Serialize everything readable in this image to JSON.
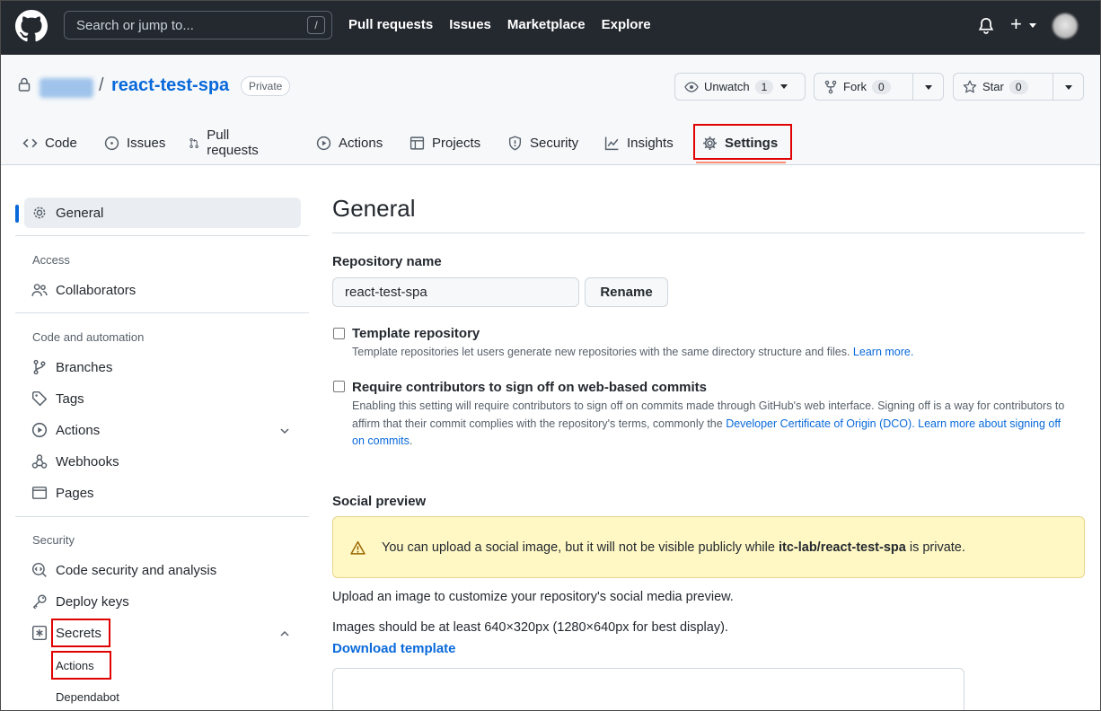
{
  "header": {
    "search_placeholder": "Search or jump to...",
    "search_key": "/",
    "nav": [
      "Pull requests",
      "Issues",
      "Marketplace",
      "Explore"
    ],
    "plus": "+"
  },
  "repo": {
    "separator": "/",
    "name": "react-test-spa",
    "visibility": "Private",
    "watch": {
      "label": "Unwatch",
      "count": "1"
    },
    "fork": {
      "label": "Fork",
      "count": "0"
    },
    "star": {
      "label": "Star",
      "count": "0"
    }
  },
  "tabs": [
    {
      "label": "Code",
      "icon": "code-icon"
    },
    {
      "label": "Issues",
      "icon": "issue-icon"
    },
    {
      "label": "Pull requests",
      "icon": "pull-request-icon"
    },
    {
      "label": "Actions",
      "icon": "play-icon"
    },
    {
      "label": "Projects",
      "icon": "table-icon"
    },
    {
      "label": "Security",
      "icon": "shield-icon"
    },
    {
      "label": "Insights",
      "icon": "graph-icon"
    },
    {
      "label": "Settings",
      "icon": "gear-icon",
      "selected": true
    }
  ],
  "sidebar": {
    "general": "General",
    "access_heading": "Access",
    "collaborators": "Collaborators",
    "code_automation_heading": "Code and automation",
    "branches": "Branches",
    "tags": "Tags",
    "actions": "Actions",
    "webhooks": "Webhooks",
    "pages": "Pages",
    "security_heading": "Security",
    "code_security": "Code security and analysis",
    "deploy_keys": "Deploy keys",
    "secrets": "Secrets",
    "secrets_actions": "Actions",
    "secrets_dependabot": "Dependabot"
  },
  "main": {
    "title": "General",
    "repo_name_label": "Repository name",
    "repo_name_value": "react-test-spa",
    "rename_button": "Rename",
    "template_label": "Template repository",
    "template_help": "Template repositories let users generate new repositories with the same directory structure and files.",
    "template_learn_more": "Learn more.",
    "signoff_label": "Require contributors to sign off on web-based commits",
    "signoff_help_1": "Enabling this setting will require contributors to sign off on commits made through GitHub's web interface. Signing off is a way for contributors to affirm that their commit complies with the repository's terms, commonly the",
    "signoff_dco_link": "Developer Certificate of Origin (DCO).",
    "signoff_learn_more": "Learn more about signing off on commits",
    "social_preview_label": "Social preview",
    "flash_pre": "You can upload a social image, but it will not be visible publicly while",
    "flash_repo": "itc-lab/react-test-spa",
    "flash_post": "is private.",
    "upload_text": "Upload an image to customize your repository's social media preview.",
    "size_text": "Images should be at least 640×320px (1280×640px for best display).",
    "download_template": "Download template"
  },
  "colors": {
    "header_bg": "#24292f",
    "link": "#0969da",
    "highlight_box": "#e00000",
    "flash_bg": "#fff8c5",
    "tab_underline": "#fd8c73"
  }
}
